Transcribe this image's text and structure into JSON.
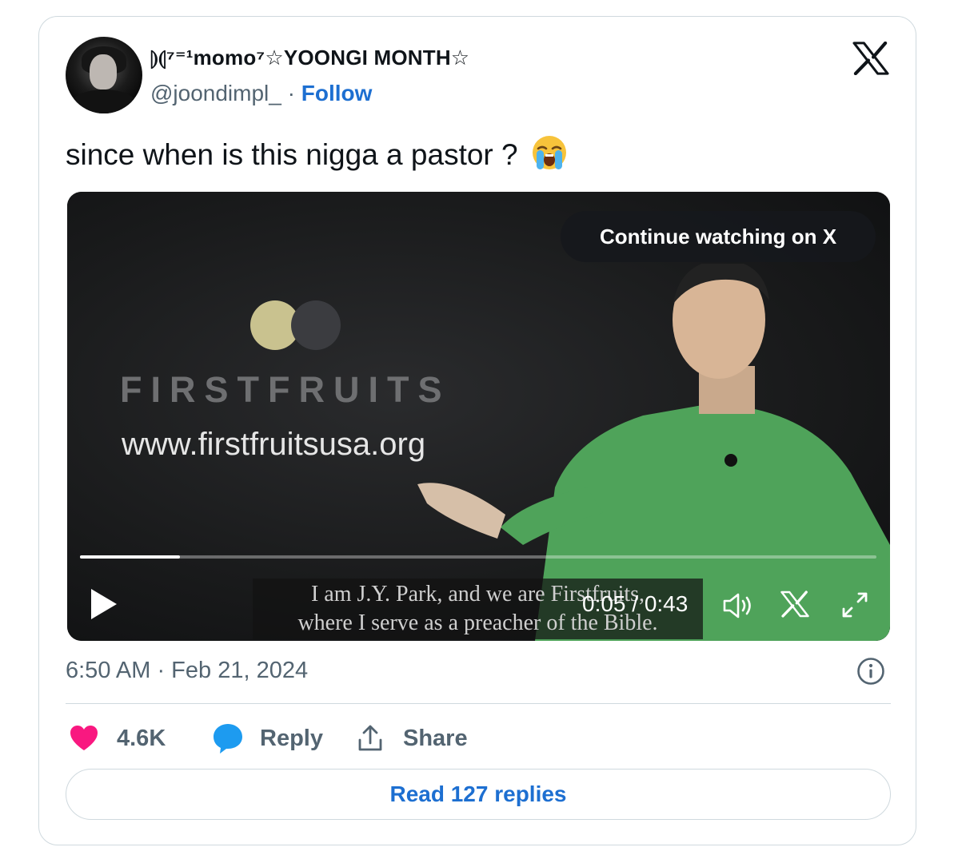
{
  "user": {
    "display_name": "⦈⦇⁷⁼¹momo⁷☆YOONGI MONTH☆",
    "handle": "@joondimpl_",
    "separator": "·",
    "follow_label": "Follow"
  },
  "tweet": {
    "text": "since when is this nigga a pastor ?",
    "emoji": "loudly-crying-face"
  },
  "video": {
    "brand": "FIRSTFRUITS",
    "url": "www.firstfruitsusa.org",
    "continue_label": "Continue watching on X",
    "subtitle_line1": "I am J.Y. Park, and we are Firstfruits,",
    "subtitle_line2": "where I serve as a preacher of the Bible.",
    "time_display": "0:05 / 0:43",
    "progress": 0.125
  },
  "meta": {
    "timestamp": "6:50 AM · Feb 21, 2024"
  },
  "actions": {
    "likes": "4.6K",
    "reply_label": "Reply",
    "share_label": "Share",
    "read_replies_label": "Read 127 replies"
  },
  "colors": {
    "accent": "#1d6fd1",
    "like": "#f91880",
    "reply_icon": "#1d9bf0",
    "muted": "#536471",
    "shirt": "#4fa35a"
  }
}
